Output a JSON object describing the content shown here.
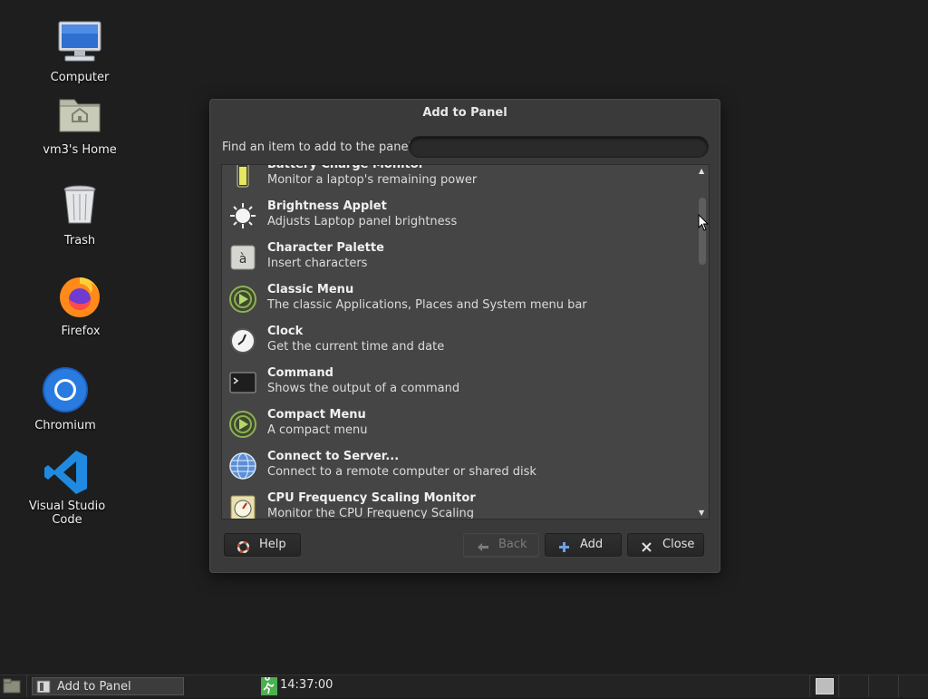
{
  "desktop": {
    "icons": [
      {
        "label": "Computer",
        "icon": "computer-icon"
      },
      {
        "label": "vm3's Home",
        "icon": "home-folder-icon"
      },
      {
        "label": "Trash",
        "icon": "trash-icon"
      },
      {
        "label": "Firefox",
        "icon": "firefox-icon"
      },
      {
        "label": "Chromium",
        "icon": "chromium-icon"
      },
      {
        "label": "Visual Studio Code",
        "icon": "vscode-icon"
      }
    ]
  },
  "dialog": {
    "title": "Add to Panel",
    "find_label": "Find an item to add to the panel:",
    "search_value": "",
    "items": [
      {
        "name": "Battery Charge Monitor",
        "desc": "Monitor a laptop's remaining power",
        "icon": "battery-icon"
      },
      {
        "name": "Brightness Applet",
        "desc": "Adjusts Laptop panel brightness",
        "icon": "brightness-icon"
      },
      {
        "name": "Character Palette",
        "desc": "Insert characters",
        "icon": "character-palette-icon"
      },
      {
        "name": "Classic Menu",
        "desc": "The classic Applications, Places and System menu bar",
        "icon": "classic-menu-icon"
      },
      {
        "name": "Clock",
        "desc": "Get the current time and date",
        "icon": "clock-icon"
      },
      {
        "name": "Command",
        "desc": "Shows the output of a command",
        "icon": "terminal-icon"
      },
      {
        "name": "Compact Menu",
        "desc": "A compact menu",
        "icon": "compact-menu-icon"
      },
      {
        "name": "Connect to Server...",
        "desc": "Connect to a remote computer or shared disk",
        "icon": "globe-icon"
      },
      {
        "name": "CPU Frequency Scaling Monitor",
        "desc": "Monitor the CPU Frequency Scaling",
        "icon": "cpu-freq-icon"
      }
    ],
    "buttons": {
      "help": "Help",
      "back": "Back",
      "add": "Add",
      "close": "Close"
    }
  },
  "taskbar": {
    "task_label": "Add to Panel",
    "clock": "14:37:00"
  },
  "colors": {
    "desktop_bg": "#1e1e1e",
    "dialog_bg": "#3a3a3a",
    "list_bg": "#454545"
  }
}
